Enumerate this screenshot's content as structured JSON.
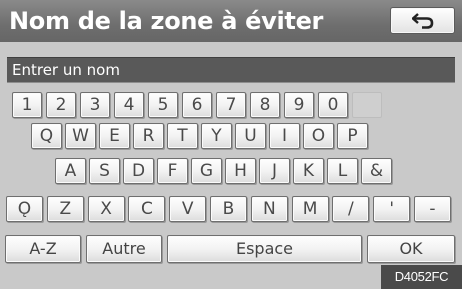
{
  "header": {
    "title": "Nom de la zone à éviter"
  },
  "back_button": {
    "icon": "back-arrow-icon"
  },
  "input": {
    "placeholder": "Entrer un nom"
  },
  "keyboard": {
    "rows": [
      [
        "1",
        "2",
        "3",
        "4",
        "5",
        "6",
        "7",
        "8",
        "9",
        "0",
        ""
      ],
      [
        "Q",
        "W",
        "E",
        "R",
        "T",
        "Y",
        "U",
        "I",
        "O",
        "P"
      ],
      [
        "A",
        "S",
        "D",
        "F",
        "G",
        "H",
        "J",
        "K",
        "L",
        "&"
      ],
      [
        "Ǫ",
        "Z",
        "X",
        "C",
        "V",
        "B",
        "N",
        "M",
        "/",
        "'",
        "-"
      ]
    ]
  },
  "bottom_bar": {
    "az_label": "A-Z",
    "other_label": "Autre",
    "space_label": "Espace",
    "ok_label": "OK"
  },
  "footer": {
    "model_code": "D4052FC"
  }
}
